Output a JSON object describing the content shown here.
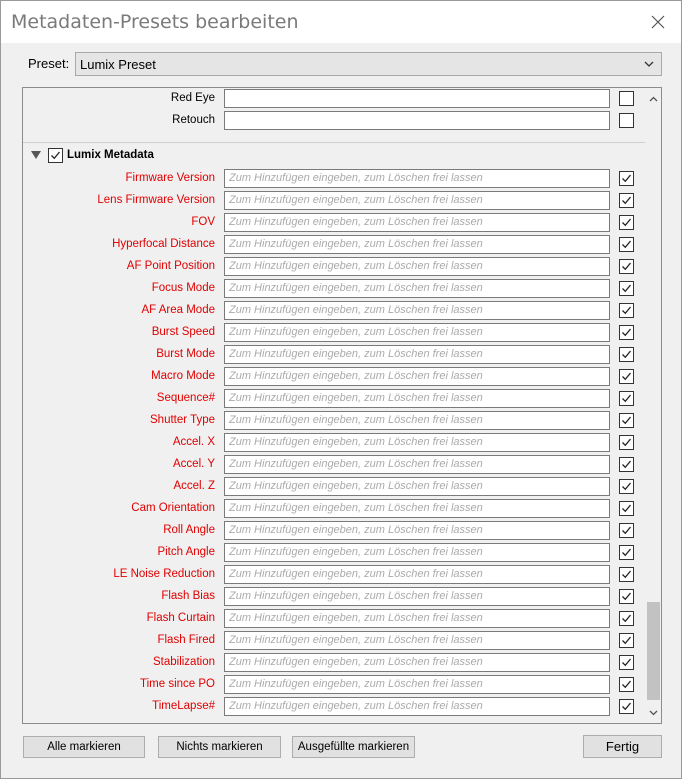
{
  "window": {
    "title": "Metadaten-Presets bearbeiten"
  },
  "preset": {
    "label": "Preset:",
    "selected": "Lumix Preset"
  },
  "top_rows": [
    {
      "label": "Red Eye",
      "value": ""
    },
    {
      "label": "Retouch",
      "value": ""
    }
  ],
  "group": {
    "title": "Lumix Metadata",
    "placeholder": "Zum Hinzufügen eingeben, zum Löschen frei lassen",
    "fields": [
      "Firmware Version",
      "Lens Firmware Version",
      "FOV",
      "Hyperfocal Distance",
      "AF Point Position",
      "Focus Mode",
      "AF Area Mode",
      "Burst Speed",
      "Burst Mode",
      "Macro Mode",
      "Sequence#",
      "Shutter Type",
      "Accel. X",
      "Accel. Y",
      "Accel. Z",
      "Cam Orientation",
      "Roll Angle",
      "Pitch Angle",
      "LE Noise Reduction",
      "Flash Bias",
      "Flash Curtain",
      "Flash Fired",
      "Stabilization",
      "Time since PO",
      "TimeLapse#"
    ]
  },
  "buttons": {
    "select_all": "Alle markieren",
    "select_none": "Nichts markieren",
    "select_filled": "Ausgefüllte markieren",
    "done": "Fertig"
  },
  "colors": {
    "field_label_red": "#e00000"
  }
}
